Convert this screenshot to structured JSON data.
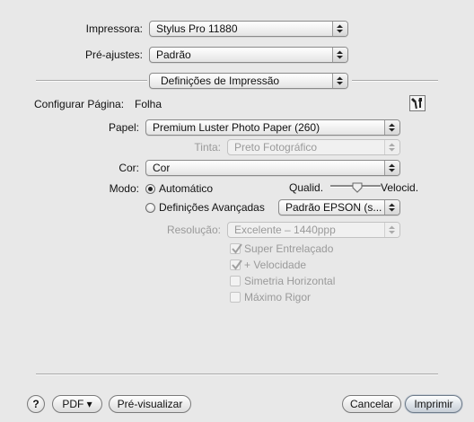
{
  "printer": {
    "label": "Impressora:",
    "value": "Stylus Pro 11880"
  },
  "presets": {
    "label": "Pré-ajustes:",
    "value": "Padrão"
  },
  "panel": {
    "value": "Definições de Impressão"
  },
  "page_setup": {
    "label": "Configurar Página:",
    "value": "Folha"
  },
  "paper": {
    "label": "Papel:",
    "value": "Premium Luster Photo Paper (260)"
  },
  "ink": {
    "label": "Tinta:",
    "value": "Preto Fotográfico"
  },
  "color": {
    "label": "Cor:",
    "value": "Cor"
  },
  "mode": {
    "label": "Modo:",
    "automatic": "Automático",
    "advanced": "Definições Avançadas",
    "selected": "automatic"
  },
  "quality_slider": {
    "left_label": "Qualid.",
    "right_label": "Velocid.",
    "level": 0.55
  },
  "advanced_preset": {
    "value": "Padrão EPSON (s..."
  },
  "resolution": {
    "label": "Resolução:",
    "value": "Excelente – 1440ppp"
  },
  "options": [
    {
      "label": "Super Entrelaçado",
      "checked": true
    },
    {
      "label": "+ Velocidade",
      "checked": true
    },
    {
      "label": "Simetria Horizontal",
      "checked": false
    },
    {
      "label": "Máximo Rigor",
      "checked": false
    }
  ],
  "footer": {
    "help": "?",
    "pdf": "PDF ▾",
    "preview": "Pré-visualizar",
    "cancel": "Cancelar",
    "print": "Imprimir"
  }
}
